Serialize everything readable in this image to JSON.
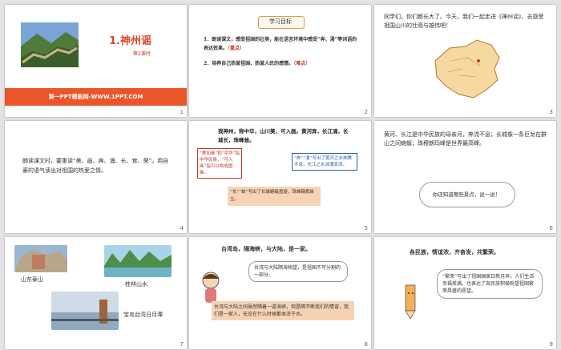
{
  "slides": [
    {
      "num": "1",
      "title": "1.神州谣",
      "subtitle": "第2课时",
      "footer": "第一PPT模板网-WWW.1PPT.COM"
    },
    {
      "num": "2",
      "header": "学习目标",
      "goal1": "1．朗读课文，感受祖国的壮美，能在语言环境中感受“奔、涌”等词语的表达效果。",
      "goal1_tag": "（重点）",
      "goal2": "2．培养自己热爱祖国、热爱人民的感情。",
      "goal2_tag": "（难点）"
    },
    {
      "num": "3",
      "text": "同学们，你们都长大了。今天，我们一起走进《神州谣》，去感受祖国山川的壮观与雄伟吧！"
    },
    {
      "num": "4",
      "text": "朗读课文时，要重读“美、画、奔、涌、长、耸、荣”，用自豪的语气读出对祖国的热爱之情。"
    },
    {
      "num": "5",
      "poem": "我神州，称中华，山川美，可入画。黄河奔，长江涌，长城长，珠峰耸。",
      "note_left": "“美如画”和“中华”指中华民族，“可入画”指可以构成图画。",
      "note_right": "“奔”“涌”写出了黄河之水奔腾不息，长江之水汹涌澎湃。",
      "note_bottom": "“长”“耸”写出了长城蜿蜒盘旋，珠峰巍峨耸立。"
    },
    {
      "num": "6",
      "text": "黄河、长江是中华民族的母亲河，奔流不息；长城像一条巨龙在群山之间蜿蜒；珠穆朗玛峰是世界最高峰。",
      "bubble": "你还知道哪些景点，说一说！"
    },
    {
      "num": "7",
      "label1": "山东泰山",
      "label2": "桂林山水",
      "label3": "宝岛台湾日月潭"
    },
    {
      "num": "8",
      "poem": "台湾岛，隔海峡，与大陆，是一家。",
      "bubble1": "台湾与大陆隔海相望，是祖国不可分割的一部分。",
      "bubble2": "台湾与大陆之间虽然隔着一道海峡，但是隔不断我们的情谊，我们是一家人，无论在什么时候都血浓于水。"
    },
    {
      "num": "9",
      "poem": "各民族，情谊浓，齐奋发，共繁荣。",
      "bubble": "“繁荣”写出了祖国国家日新月异，人们生活幸福美满。也表达了各民族积极盼望祖国繁荣昌盛的愿望。"
    }
  ],
  "colors": {
    "orange": "#e8562a",
    "accent_red": "#c0392b",
    "poem_blue": "#2b5fa8"
  }
}
